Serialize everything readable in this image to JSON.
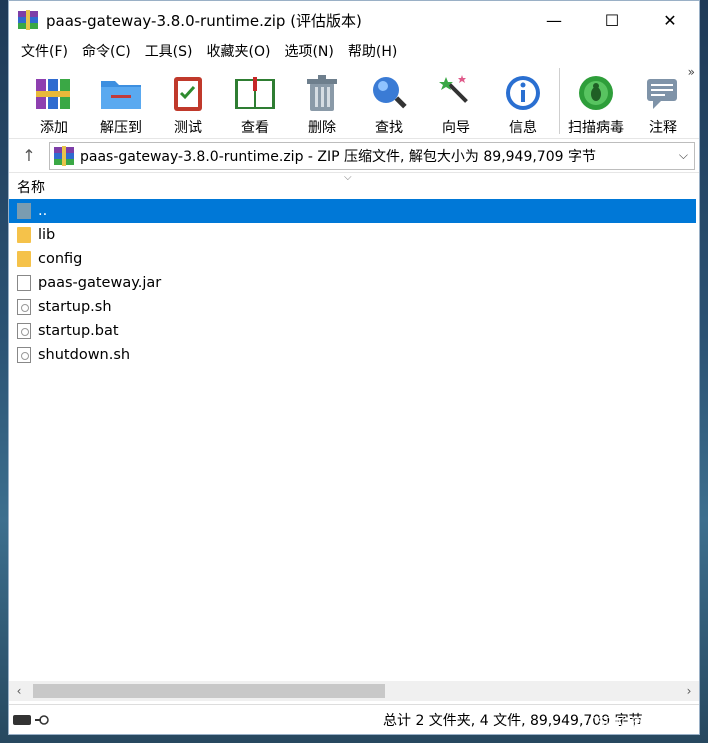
{
  "window": {
    "title": "paas-gateway-3.8.0-runtime.zip (评估版本)",
    "controls": {
      "minimize": "—",
      "maximize": "☐",
      "close": "✕"
    }
  },
  "menu": [
    "文件(F)",
    "命令(C)",
    "工具(S)",
    "收藏夹(O)",
    "选项(N)",
    "帮助(H)"
  ],
  "toolbar": {
    "items": [
      {
        "label": "添加",
        "icon": "add-books-icon"
      },
      {
        "label": "解压到",
        "icon": "extract-folder-icon"
      },
      {
        "label": "测试",
        "icon": "test-clipboard-icon"
      },
      {
        "label": "查看",
        "icon": "view-book-icon"
      },
      {
        "label": "删除",
        "icon": "trash-can-icon"
      },
      {
        "label": "查找",
        "icon": "magnifier-icon"
      },
      {
        "label": "向导",
        "icon": "wizard-wand-icon"
      },
      {
        "label": "信息",
        "icon": "info-icon"
      },
      {
        "label": "扫描病毒",
        "icon": "virus-scan-icon"
      },
      {
        "label": "注释",
        "icon": "comment-icon"
      }
    ],
    "overflow": "»"
  },
  "address": {
    "up": "↑",
    "path": "paas-gateway-3.8.0-runtime.zip - ZIP 压缩文件, 解包大小为 89,949,709 字节",
    "dropdown": "⌵"
  },
  "list": {
    "column_name": "名称",
    "sort_indicator": "⌵",
    "rows": [
      {
        "name": "..",
        "type": "parent",
        "selected": true
      },
      {
        "name": "lib",
        "type": "folder"
      },
      {
        "name": "config",
        "type": "folder"
      },
      {
        "name": "paas-gateway.jar",
        "type": "java"
      },
      {
        "name": "startup.sh",
        "type": "file"
      },
      {
        "name": "startup.bat",
        "type": "file"
      },
      {
        "name": "shutdown.sh",
        "type": "file"
      }
    ]
  },
  "scrollbar": {
    "left": "‹",
    "right": "›"
  },
  "status": {
    "text": "总计 2 文件夹, 4 文件, 89,949,709 字节"
  },
  "watermark": "CSDN @新程序猿",
  "colors": {
    "selection": "#0078d7",
    "window_bg": "#ffffff"
  }
}
